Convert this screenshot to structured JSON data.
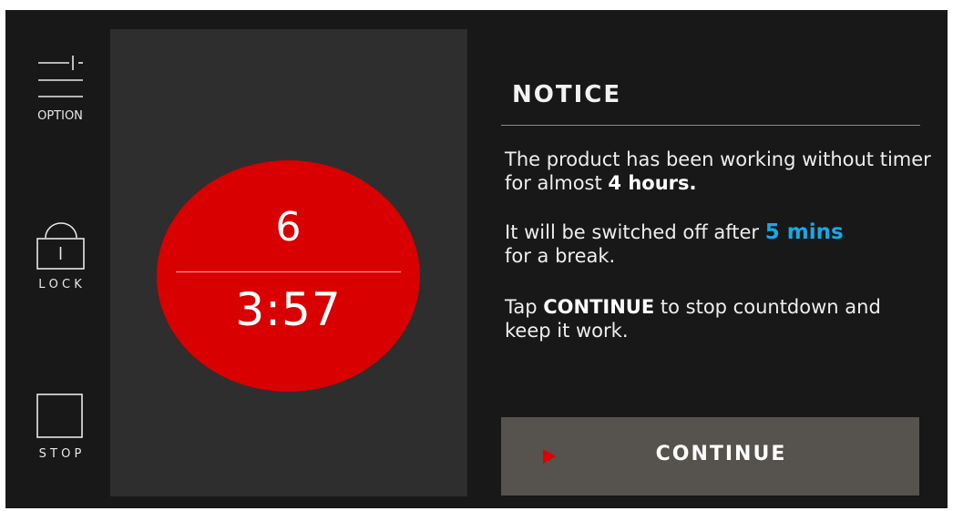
{
  "sidebar": {
    "option_label": "OPTION",
    "lock_label": "L O C K",
    "stop_label": "S T O P"
  },
  "timer": {
    "level": "6",
    "time": "3:57",
    "dial_color": "#d80000"
  },
  "notice": {
    "title": "NOTICE",
    "line1_text": "The product has been working without timer for almost",
    "line1_emphasis": "4 hours.",
    "line2_text": "It will be switched off after",
    "line2_emphasis": "5 mins",
    "line2_suffix": "for a break.",
    "line3_prefix": "Tap",
    "line3_emphasis": "CONTINUE",
    "line3_suffix": "to stop countdown and keep it work.",
    "accent_color": "#18a9e6"
  },
  "continue_button": {
    "label": "CONTINUE",
    "arrow_icon": "play-arrow-icon"
  }
}
